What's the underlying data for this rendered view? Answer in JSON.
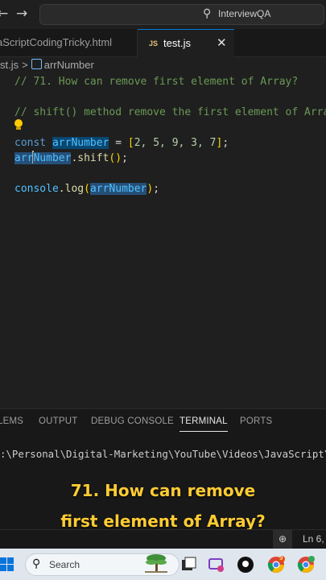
{
  "titlebar": {
    "back_icon": "arrow-left-icon",
    "forward_icon": "arrow-right-icon",
    "search_text": "InterviewQA"
  },
  "tabs": [
    {
      "label": "aScriptCodingTricky.html",
      "active": false
    },
    {
      "label": "test.js",
      "icon_text": "JS",
      "active": true,
      "close": "✕"
    }
  ],
  "breadcrumb": {
    "file": "st.js",
    "separator": ">",
    "symbol": "arrNumber"
  },
  "editor": {
    "line1": "// 71. How can remove first element of Array?",
    "line2": "// shift() method remove the first element of Array",
    "line3_kw": "const",
    "line3_var": "arrNumber",
    "line3_eq": " = ",
    "line3_open": "[",
    "line3_vals": "2, 5, 9, 3, 7",
    "line3_close": "]",
    "line3_end": ";",
    "line4_var_a": "arr",
    "line4_var_b": "Number",
    "line4_method": ".shift",
    "line4_paren": "()",
    "line4_end": ";",
    "line5_obj": "console",
    "line5_log": ".log",
    "line5_open": "(",
    "line5_arg": "arrNumber",
    "line5_close": ")",
    "line5_end": ";"
  },
  "panel": {
    "tabs": [
      "LEMS",
      "OUTPUT",
      "DEBUG CONSOLE",
      "TERMINAL",
      "PORTS"
    ],
    "active_tab": "TERMINAL"
  },
  "terminal": {
    "path_line": ":\\Personal\\Digital-Marketing\\YouTube\\Videos\\JavaScript\\J"
  },
  "overlay": {
    "line1": "71. How can remove",
    "line2": "first element of Array?",
    "color": "#ffcc33"
  },
  "statusbar": {
    "zoom_icon": "zoom-in-icon",
    "position": "Ln 6,"
  },
  "taskbar": {
    "search_label": "Search",
    "badge_count": "9"
  },
  "colors": {
    "accent": "#0078d4",
    "keyword": "#569cd6",
    "variable": "#4fc1ff",
    "comment": "#6a9955"
  }
}
